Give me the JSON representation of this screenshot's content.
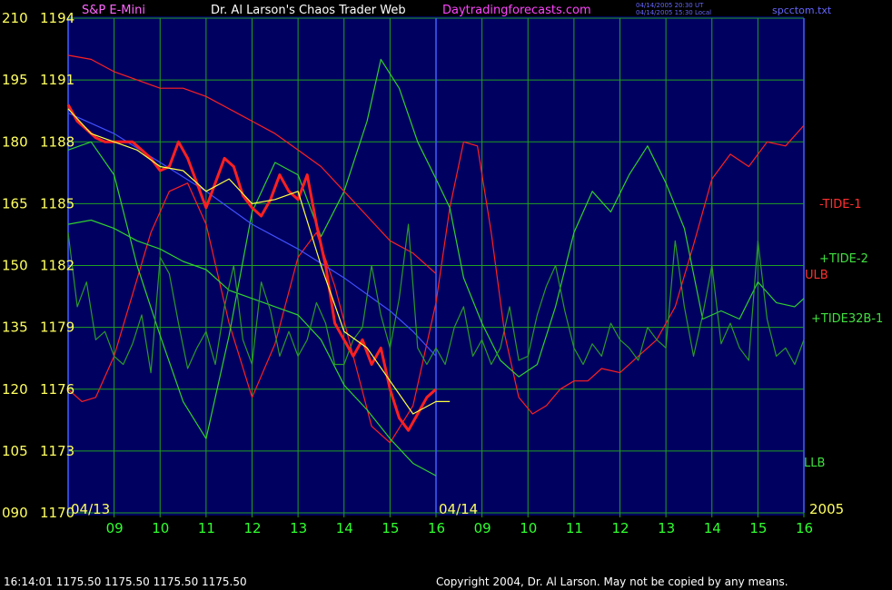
{
  "header": {
    "symbol": "S&P E-Mini",
    "title": "Dr. Al Larson's Chaos Trader Web",
    "site": "Daytradingforecasts.com",
    "stamp_utc": "04/14/2005 20:30 UT",
    "stamp_local": "04/14/2005 15:30 Local",
    "file": "spcctom.txt"
  },
  "footer": {
    "quote": "16:14:01  1175.50 1175.50 1175.50 1175.50",
    "copyright": "Copyright 2004, Dr. Al Larson. May not be copied by any means."
  },
  "chart_data": {
    "type": "line",
    "y_left_labels": [
      {
        "tide": "210",
        "price": "1194"
      },
      {
        "tide": "195",
        "price": "1191"
      },
      {
        "tide": "180",
        "price": "1188"
      },
      {
        "tide": "165",
        "price": "1185"
      },
      {
        "tide": "150",
        "price": "1182"
      },
      {
        "tide": "135",
        "price": "1179"
      },
      {
        "tide": "120",
        "price": "1176"
      },
      {
        "tide": "105",
        "price": "1173"
      },
      {
        "tide": "090",
        "price": "1170"
      }
    ],
    "ylim_price": [
      1170,
      1194
    ],
    "ylim_tide": [
      90,
      210
    ],
    "xlim_hours": [
      8,
      24
    ],
    "x_tick_labels": [
      "09",
      "10",
      "11",
      "12",
      "13",
      "14",
      "15",
      "16",
      "09",
      "10",
      "11",
      "12",
      "13",
      "14",
      "15",
      "16"
    ],
    "x_tick_positions": [
      9,
      10,
      11,
      12,
      13,
      14,
      15,
      16,
      17,
      18,
      19,
      20,
      21,
      22,
      23,
      24
    ],
    "date_labels": [
      {
        "text": "04/13",
        "x": 8
      },
      {
        "text": "04/14",
        "x": 16
      },
      {
        "text": "2005",
        "x": 24
      }
    ],
    "series": [
      {
        "name": "-TIDE-1",
        "color": "#ff2020",
        "x": [
          8,
          8.3,
          8.6,
          9,
          9.4,
          9.8,
          10.2,
          10.6,
          11,
          11.5,
          12,
          12.5,
          13,
          13.4,
          13.8,
          14.2,
          14.6,
          15,
          15.5,
          16,
          16.3,
          16.6,
          16.9,
          17.2,
          17.5,
          17.8,
          18.1,
          18.4,
          18.7,
          19,
          19.3,
          19.6,
          20,
          20.4,
          20.8,
          21.2,
          21.6,
          22,
          22.4,
          22.8,
          23.2,
          23.6,
          24
        ],
        "values": [
          120,
          117,
          118,
          128,
          143,
          158,
          168,
          170,
          160,
          136,
          118,
          131,
          152,
          158,
          145,
          128,
          111,
          107,
          116,
          141,
          164,
          180,
          179,
          158,
          133,
          118,
          114,
          116,
          120,
          122,
          122,
          125,
          124,
          128,
          132,
          140,
          155,
          171,
          177,
          174,
          180,
          179,
          184
        ]
      },
      {
        "name": "+TIDE-2",
        "color": "#30d030",
        "x": [
          8,
          8.5,
          9,
          9.5,
          10,
          10.5,
          11,
          11.5,
          12,
          12.5,
          13,
          13.5,
          14,
          14.5,
          14.8,
          15.2,
          15.6,
          16,
          16.3,
          16.6,
          17,
          17.4,
          17.8,
          18.2,
          18.6,
          19,
          19.4,
          19.8,
          20.2,
          20.6,
          21,
          21.4,
          21.8,
          22.2,
          22.6,
          23,
          23.4,
          23.8,
          24
        ],
        "values": [
          178,
          180,
          172,
          150,
          133,
          117,
          108,
          133,
          163,
          175,
          172,
          157,
          168,
          185,
          200,
          193,
          180,
          171,
          164,
          147,
          136,
          127,
          123,
          126,
          140,
          158,
          168,
          163,
          172,
          179,
          170,
          159,
          137,
          139,
          137,
          146,
          141,
          140,
          142
        ]
      },
      {
        "name": "+TIDE32B-1",
        "color": "#30d030",
        "x": [
          8,
          8.5,
          9,
          9.5,
          10,
          10.5,
          11,
          11.5,
          12,
          12.5,
          13,
          13.5,
          14,
          14.5,
          15,
          15.5,
          16
        ],
        "values": [
          160,
          161,
          159,
          156,
          154,
          151,
          149,
          144,
          142,
          140,
          138,
          132,
          121,
          115,
          108,
          102,
          99
        ]
      },
      {
        "name": "blue-line",
        "color": "#4050ff",
        "x": [
          8,
          9,
          10,
          11,
          12,
          13,
          14,
          15,
          15.5,
          16
        ],
        "values": [
          187,
          182,
          175,
          168,
          160,
          154,
          147,
          139,
          134,
          128
        ]
      },
      {
        "name": "ULB",
        "color": "#ff2020",
        "x": [
          8,
          8.5,
          9,
          9.5,
          10,
          10.5,
          11,
          11.5,
          12,
          12.5,
          13,
          13.5,
          14,
          14.5,
          15,
          15.5,
          16
        ],
        "values": [
          201,
          200,
          197,
          195,
          193,
          193,
          191,
          188,
          185,
          182,
          178,
          174,
          168,
          162,
          156,
          153,
          148
        ]
      },
      {
        "name": "fast-oscillator",
        "color": "#2a9a2a",
        "x": [
          8,
          8.2,
          8.4,
          8.6,
          8.8,
          9,
          9.2,
          9.4,
          9.6,
          9.8,
          10,
          10.2,
          10.4,
          10.6,
          10.8,
          11,
          11.2,
          11.4,
          11.6,
          11.8,
          12,
          12.2,
          12.4,
          12.6,
          12.8,
          13,
          13.2,
          13.4,
          13.6,
          13.8,
          14,
          14.2,
          14.4,
          14.6,
          14.8,
          15,
          15.2,
          15.4,
          15.6,
          15.8,
          16,
          16.2,
          16.4,
          16.6,
          16.8,
          17,
          17.2,
          17.4,
          17.6,
          17.8,
          18,
          18.2,
          18.4,
          18.6,
          18.8,
          19,
          19.2,
          19.4,
          19.6,
          19.8,
          20,
          20.2,
          20.4,
          20.6,
          20.8,
          21,
          21.2,
          21.4,
          21.6,
          21.8,
          22,
          22.2,
          22.4,
          22.6,
          22.8,
          23,
          23.2,
          23.4,
          23.6,
          23.8,
          24
        ],
        "values": [
          158,
          140,
          146,
          132,
          134,
          128,
          126,
          131,
          138,
          124,
          152,
          148,
          136,
          125,
          130,
          134,
          126,
          140,
          150,
          132,
          126,
          146,
          139,
          128,
          134,
          128,
          132,
          141,
          136,
          126,
          126,
          132,
          135,
          150,
          138,
          130,
          142,
          160,
          130,
          126,
          130,
          126,
          135,
          140,
          128,
          132,
          126,
          130,
          140,
          127,
          128,
          138,
          145,
          150,
          139,
          130,
          126,
          131,
          128,
          136,
          132,
          130,
          127,
          135,
          132,
          130,
          156,
          140,
          128,
          138,
          150,
          131,
          136,
          130,
          127,
          156,
          137,
          128,
          130,
          126,
          132
        ]
      },
      {
        "name": "price-bars",
        "color": "#ff2020",
        "x": [
          8,
          8.2,
          8.4,
          8.6,
          8.8,
          9,
          9.2,
          9.4,
          9.6,
          9.8,
          10,
          10.2,
          10.4,
          10.6,
          10.8,
          11,
          11.2,
          11.4,
          11.6,
          11.8,
          12,
          12.2,
          12.4,
          12.6,
          12.8,
          13,
          13.2,
          13.4,
          13.6,
          13.8,
          14,
          14.2,
          14.4,
          14.6,
          14.8,
          15,
          15.2,
          15.4,
          15.6,
          15.8,
          16
        ],
        "values": [
          189,
          185,
          183,
          181,
          180,
          180,
          180,
          180,
          178,
          176,
          173,
          174,
          180,
          176,
          170,
          164,
          170,
          176,
          174,
          167,
          164,
          162,
          166,
          172,
          168,
          166,
          172,
          160,
          150,
          136,
          132,
          128,
          132,
          126,
          130,
          120,
          113,
          110,
          114,
          118,
          120
        ]
      },
      {
        "name": "price-average",
        "color": "#ffff40",
        "x": [
          8,
          8.5,
          9,
          9.5,
          10,
          10.5,
          11,
          11.5,
          12,
          12.5,
          13,
          13.5,
          14,
          14.5,
          15,
          15.5,
          16,
          16.3
        ],
        "values": [
          188,
          182,
          180,
          178,
          174,
          173,
          168,
          171,
          165,
          166,
          168,
          150,
          134,
          130,
          122,
          114,
          117,
          117
        ]
      }
    ],
    "legend": [
      "-TIDE-1",
      "+TIDE-2",
      "ULB",
      "+TIDE32B-1",
      "LLB"
    ],
    "legend_placement": "right",
    "grid": true
  }
}
